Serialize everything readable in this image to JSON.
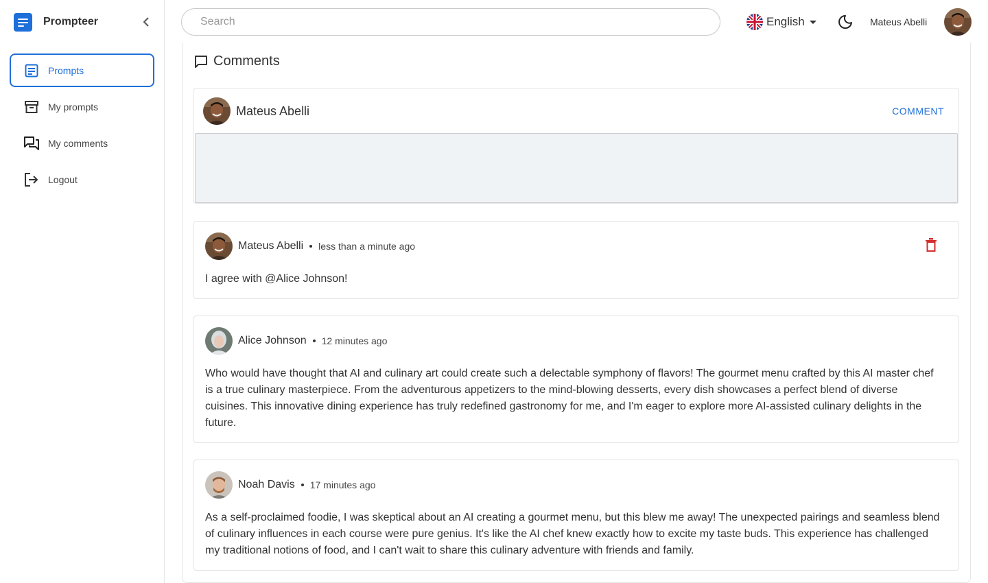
{
  "app": {
    "name": "Prompteer"
  },
  "sidebar": {
    "items": [
      {
        "label": "Prompts",
        "icon": "prompts-icon",
        "active": true
      },
      {
        "label": "My prompts",
        "icon": "archive-icon",
        "active": false
      },
      {
        "label": "My comments",
        "icon": "comments-icon",
        "active": false
      },
      {
        "label": "Logout",
        "icon": "logout-icon",
        "active": false
      }
    ]
  },
  "header": {
    "search_placeholder": "Search",
    "language": "English",
    "user_name": "Mateus Abelli"
  },
  "comments_section": {
    "title": "Comments",
    "composer": {
      "author": "Mateus Abelli",
      "button_label": "COMMENT",
      "value": ""
    },
    "items": [
      {
        "author": "Mateus Abelli",
        "time": "less than a minute ago",
        "text": "I agree with @Alice Johnson!",
        "deletable": true
      },
      {
        "author": "Alice Johnson",
        "time": "12 minutes ago",
        "text": "Who would have thought that AI and culinary art could create such a delectable symphony of flavors! The gourmet menu crafted by this AI master chef is a true culinary masterpiece. From the adventurous appetizers to the mind-blowing desserts, every dish showcases a perfect blend of diverse cuisines. This innovative dining experience has truly redefined gastronomy for me, and I'm eager to explore more AI-assisted culinary delights in the future.",
        "deletable": false
      },
      {
        "author": "Noah Davis",
        "time": "17 minutes ago",
        "text": "As a self-proclaimed foodie, I was skeptical about an AI creating a gourmet menu, but this blew me away! The unexpected pairings and seamless blend of culinary influences in each course were pure genius. It's like the AI chef knew exactly how to excite my taste buds. This experience has challenged my traditional notions of food, and I can't wait to share this culinary adventure with friends and family.",
        "deletable": false
      }
    ]
  },
  "colors": {
    "accent": "#1e6fd9",
    "danger": "#d32f2f"
  }
}
